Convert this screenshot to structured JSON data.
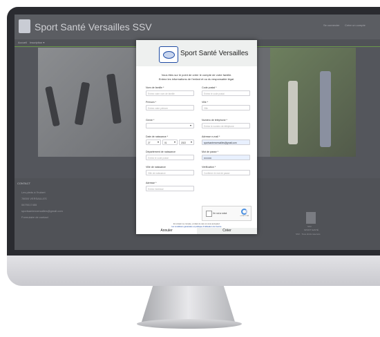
{
  "site": {
    "title": "Sport Santé Versailles SSV",
    "top_links": [
      "Se connecter",
      "Créer un compte"
    ],
    "nav": [
      "Accueil",
      "Inscription ▾"
    ],
    "contact": {
      "heading": "CONTACT",
      "lines": [
        "Les pieds à l'hubert",
        "78000 VERSAILLES",
        "0679017455",
        "sportsantenversailles@gmail.com",
        "Formulaire de contact"
      ]
    },
    "footer": {
      "brand": "SSV",
      "sub": "SPORT SANTÉ",
      "copyright": "SSV · Tous droits réservés"
    }
  },
  "modal": {
    "title": "Sport Santé Versailles",
    "intro_line1": "Vous êtes sur le point de créer le compte de votre famille.",
    "intro_line2": "Entrez les informations de l'enfant et ou du responsable légal.",
    "fields": {
      "nom_famille": {
        "label": "Nom de famille *",
        "placeholder": "Entrez votre nom de famille"
      },
      "prenom": {
        "label": "Prénom *",
        "placeholder": "Entrez votre prénom"
      },
      "genre": {
        "label": "Genre *",
        "value": ""
      },
      "date_naissance": {
        "label": "Date de naissance *",
        "day": "27",
        "month": "01",
        "year": "2022"
      },
      "departement": {
        "label": "Département de naissance",
        "placeholder": "Entrez le code postal"
      },
      "ville_naissance": {
        "label": "Ville de naissance",
        "placeholder": "Ville de naissance"
      },
      "adresse": {
        "label": "Adresse *",
        "placeholder": "Entrez l'adresse"
      },
      "code_postal": {
        "label": "Code postal *",
        "placeholder": "Entrez le code postal"
      },
      "ville": {
        "label": "Ville *",
        "placeholder": "Ville"
      },
      "telephone": {
        "label": "Numéro de téléphone *",
        "placeholder": "Entrez le numéro de téléphone"
      },
      "email": {
        "label": "Adresse e-mail *",
        "value": "sportsantenversailles@gmail.com"
      },
      "mot_de_passe": {
        "label": "Mot de passe *",
        "value": "••••••••••"
      },
      "verification": {
        "label": "Vérification *",
        "placeholder": "Confirmer le mot de passe"
      }
    },
    "recaptcha": {
      "label": "I'm not a robot",
      "brand": "reCAPTCHA"
    },
    "legal_prefix": "En créant ce compte, et dans le cas où vous acceptez",
    "legal_link": "les conditions générales et politique d'utilisation du Centre",
    "buttons": {
      "cancel": "Annuler",
      "create": "Créer"
    }
  }
}
